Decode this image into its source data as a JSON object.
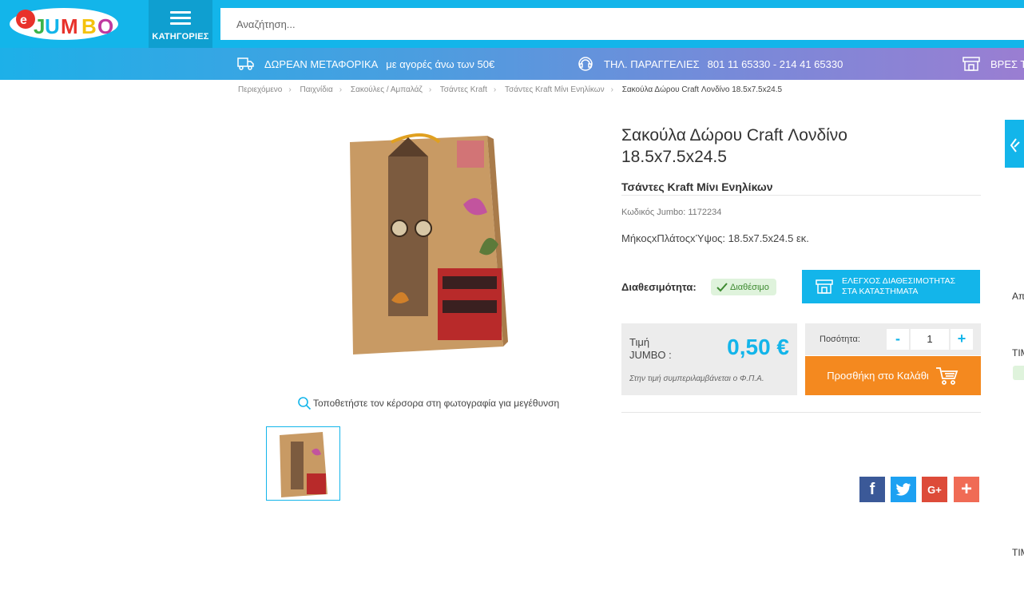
{
  "header": {
    "logo_text": "eJUMBO",
    "categories_label": "ΚΑΤΗΓΟΡΙΕΣ",
    "search_placeholder": "Αναζήτηση..."
  },
  "infobar": {
    "shipping_strong": "ΔΩΡΕΑΝ ΜΕΤΑΦΟΡΙΚΑ",
    "shipping_text": "με αγορές άνω των 50€",
    "phone_strong": "ΤΗΛ. ΠΑΡΑΓΓΕΛΙΕΣ",
    "phone_text": "801 11 65330 - 214 41 65330",
    "stores_text": "ΒΡΕΣ Τ"
  },
  "breadcrumb": [
    "Περιεχόμενο",
    "Παιχνίδια",
    "Σακούλες / Αμπαλάζ",
    "Τσάντες Kraft",
    "Τσάντες Kraft Μίνι Ενηλίκων",
    "Σακούλα Δώρου Craft Λονδίνο 18.5x7.5x24.5"
  ],
  "product": {
    "title_line1": "Σακούλα Δώρου Craft Λονδίνο",
    "title_line2": "18.5x7.5x24.5",
    "subcategory": "Τσάντες Kraft Μίνι Ενηλίκων",
    "code": "Κωδικός Jumbo: 1172234",
    "dimensions": "ΜήκοςxΠλάτοςxΎψος: 18.5x7.5x24.5 εκ.",
    "availability_label": "Διαθεσιμότητα:",
    "availability_value": "Διαθέσιμο",
    "store_check_line1": "ΕΛΕΓΧΟΣ ΔΙΑΘΕΣΙΜΟΤΗΤΑΣ",
    "store_check_line2": "ΣΤΑ ΚΑΤΑΣΤΗΜΑΤΑ",
    "price_label_line1": "Τιμή",
    "price_label_line2": "JUMBO :",
    "price": "0,50 €",
    "price_note": "Στην τιμή συμπεριλαμβάνεται ο Φ.Π.Α.",
    "quantity_label": "Ποσότητα:",
    "quantity_value": "1",
    "quantity_minus": "-",
    "quantity_plus": "+",
    "add_to_cart": "Προσθήκη στο Καλάθι",
    "zoom_hint": "Τοποθετήστε τον κέρσορα στη φωτογραφία για μεγέθυνση"
  },
  "share": {
    "facebook": "f",
    "google": "G+",
    "more": "+"
  },
  "side": {
    "text1": "Απ",
    "text2": "ΤΙΜ",
    "text3": "ΤΙΜ"
  },
  "colors": {
    "brand_blue": "#13b5ea",
    "cart_orange": "#f4891f",
    "facebook": "#3b5998",
    "twitter": "#1da1f2",
    "google": "#dd4b39",
    "more": "#f06b55"
  }
}
